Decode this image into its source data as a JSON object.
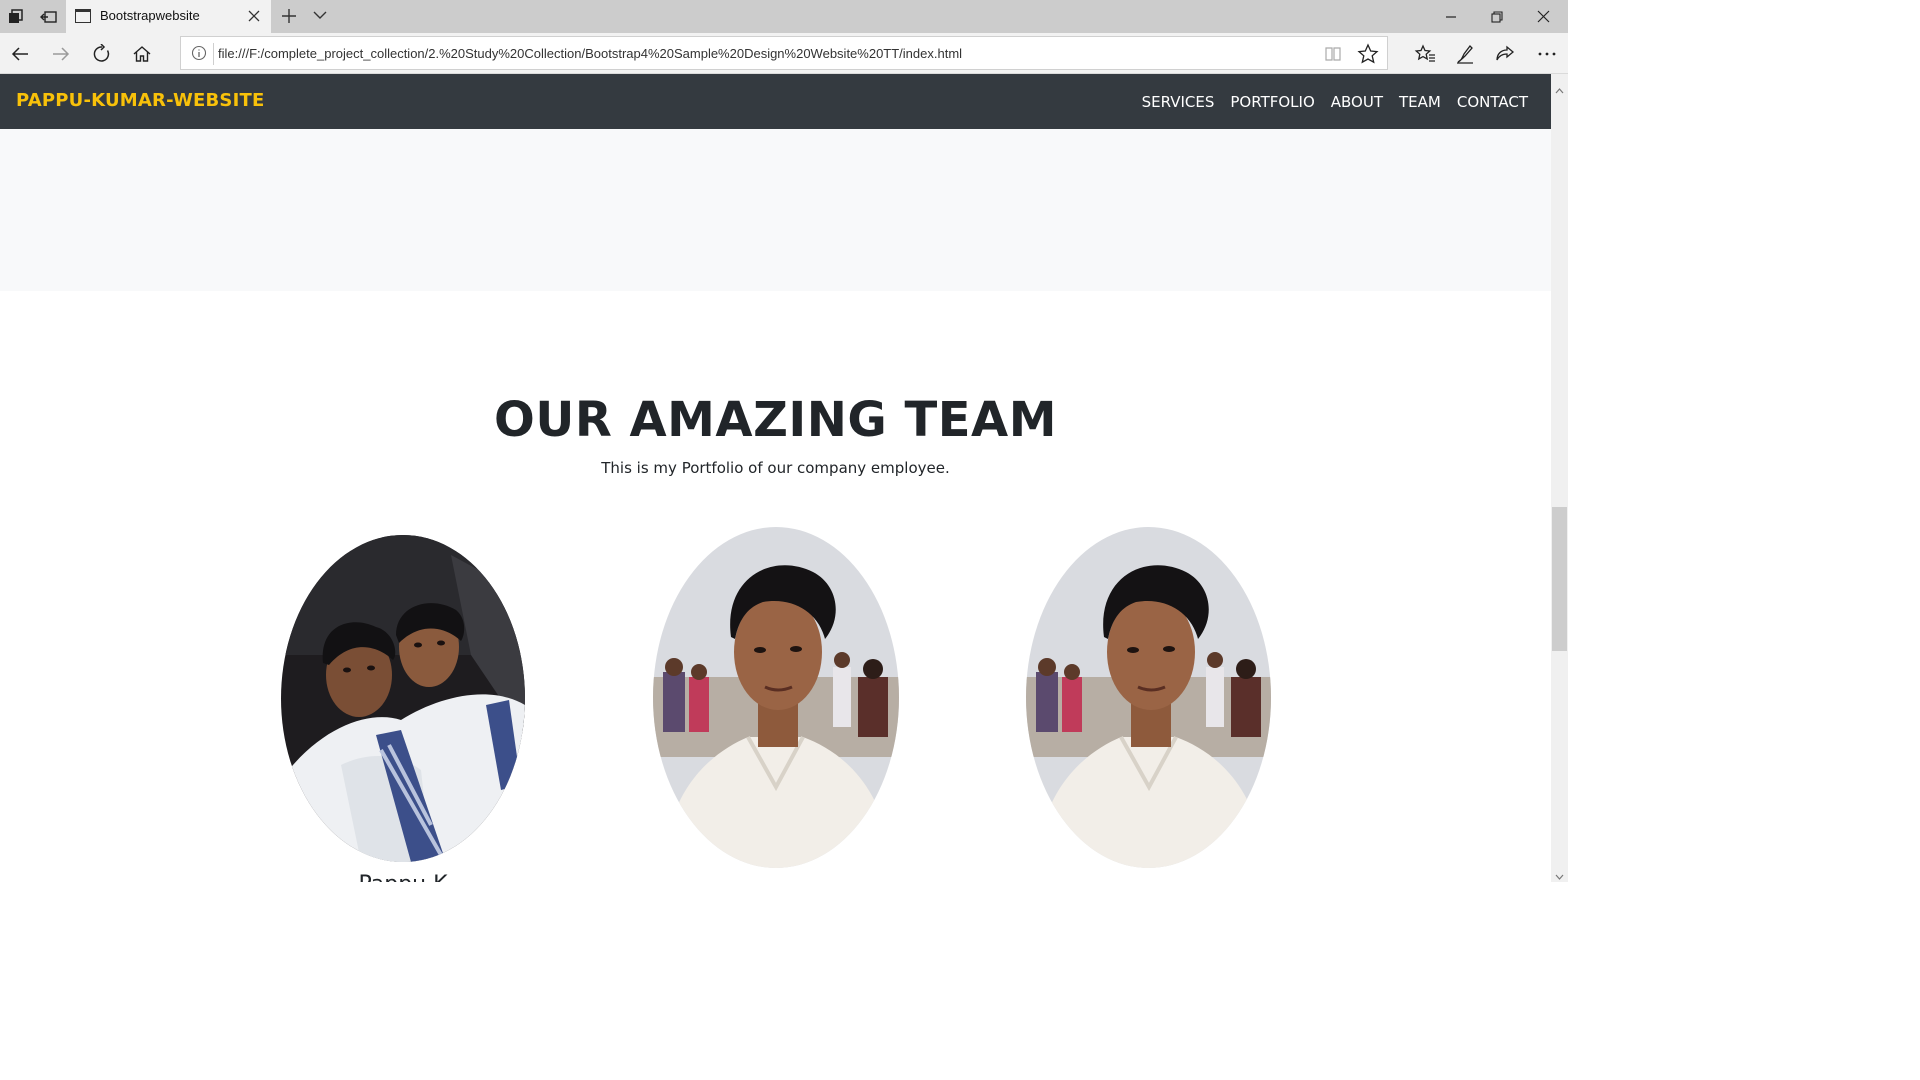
{
  "browser": {
    "tab_title": "Bootstrapwebsite",
    "url": "file:///F:/complete_project_collection/2.%20Study%20Collection/Bootstrap4%20Sample%20Design%20Website%20TT/index.html"
  },
  "site": {
    "brand": "PAPPU-KUMAR-WEBSITE",
    "brand_color": "#f8c10a",
    "nav_bg": "#343a40",
    "nav": [
      "SERVICES",
      "PORTFOLIO",
      "ABOUT",
      "TEAM",
      "CONTACT"
    ]
  },
  "team": {
    "title": "OUR AMAZING TEAM",
    "subtitle": "This is my Portfolio of our company employee.",
    "members": [
      {
        "photo": "two-people-selfie-photo",
        "name": "Pappu K"
      },
      {
        "photo": "team-member-portrait-photo",
        "name": ""
      },
      {
        "photo": "team-member-portrait-photo",
        "name": ""
      }
    ]
  }
}
